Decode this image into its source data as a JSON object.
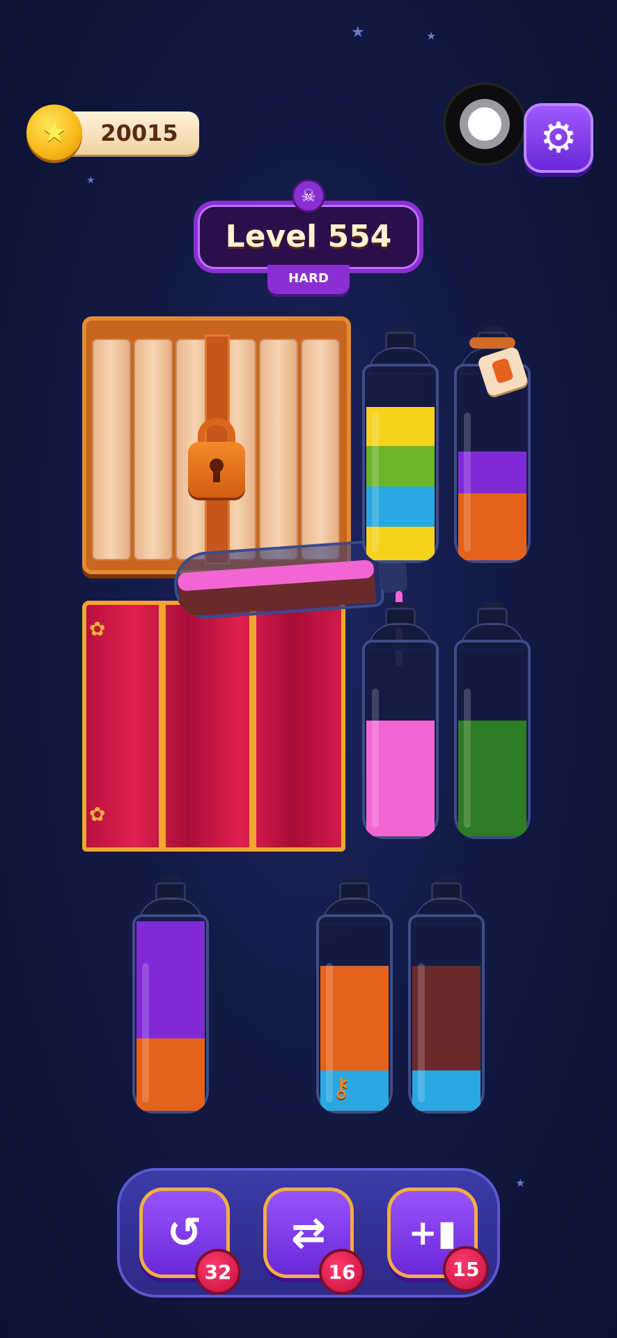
{
  "coins": {
    "value": "20015",
    "icon": "star-coin-icon"
  },
  "header": {
    "record_icon": "record-icon",
    "settings_icon": "gear-icon"
  },
  "level": {
    "title": "Level 554",
    "difficulty": "HARD",
    "badge_icon": "skull-icon"
  },
  "obstacles": {
    "crate": {
      "state": "locked",
      "icon": "padlock-icon"
    },
    "curtain": {
      "state": "closed"
    }
  },
  "pouring_tube": {
    "colors": [
      "#f266d3",
      "#6a2a2a"
    ]
  },
  "bottles": [
    {
      "id": "b1",
      "layers_top_to_bottom": [
        "#f5d21c",
        "#6bb52a",
        "#2aa7e0",
        "#f5d21c"
      ]
    },
    {
      "id": "b2",
      "layers_top_to_bottom": [
        "#7f2ad6",
        "#e5621c"
      ],
      "tag": "bottle-tag"
    },
    {
      "id": "b3",
      "layers_top_to_bottom": [
        "#f266d3"
      ]
    },
    {
      "id": "b4",
      "layers_top_to_bottom": [
        "#2f7a25"
      ]
    },
    {
      "id": "b5",
      "layers_top_to_bottom": [
        "#7f2ad6",
        "#e5621c"
      ]
    },
    {
      "id": "b6",
      "layers_top_to_bottom": [
        "#e5621c",
        "#2aa7e0"
      ],
      "key": "key-icon"
    },
    {
      "id": "b7",
      "layers_top_to_bottom": [
        "#6a2a2a",
        "#2aa7e0"
      ]
    }
  ],
  "toolbar": {
    "undo": {
      "icon": "undo-icon",
      "count": "32"
    },
    "shuffle": {
      "icon": "shuffle-icon",
      "count": "16"
    },
    "add_bottle": {
      "icon": "add-bottle-icon",
      "count": "15"
    }
  }
}
